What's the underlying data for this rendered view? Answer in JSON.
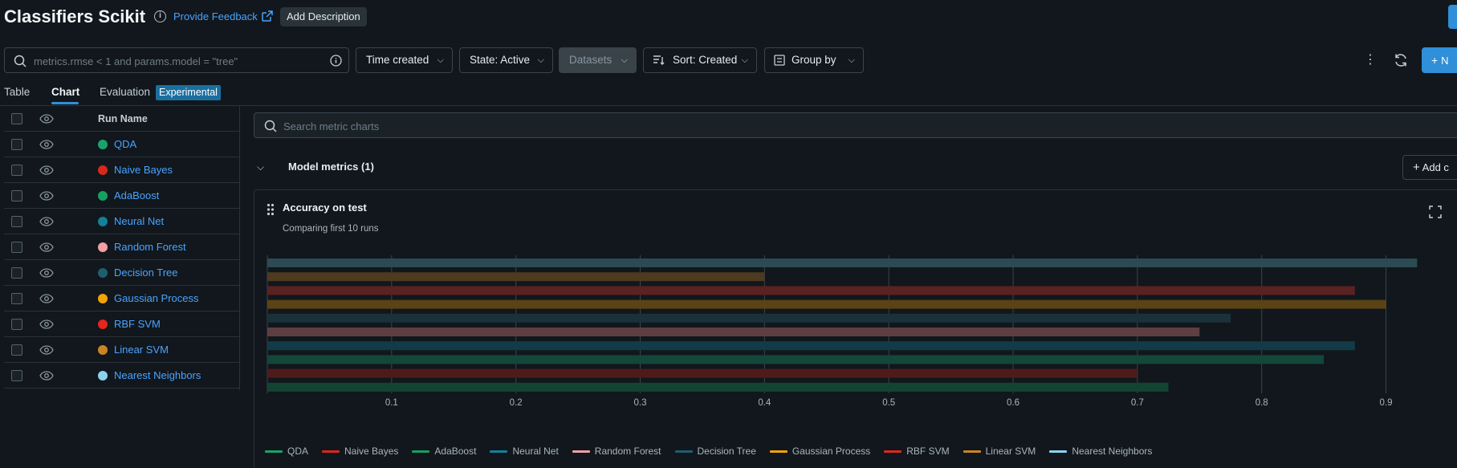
{
  "header": {
    "title": "Classifiers Scikit",
    "feedback_label": "Provide Feedback",
    "add_description_label": "Add Description"
  },
  "toolbar": {
    "search_placeholder": "metrics.rmse < 1 and params.model = \"tree\"",
    "time_created_label": "Time created",
    "state_label": "State: Active",
    "datasets_label": "Datasets",
    "sort_label": "Sort: Created",
    "group_by_label": "Group by",
    "new_label": "N"
  },
  "tabs": [
    {
      "label": "Table"
    },
    {
      "label": "Chart"
    },
    {
      "label": "Evaluation"
    }
  ],
  "experimental_badge": "Experimental",
  "runs_table": {
    "column_header": "Run Name",
    "runs": [
      {
        "name": "QDA",
        "color": "#1aa36b"
      },
      {
        "name": "Naive Bayes",
        "color": "#d6281c"
      },
      {
        "name": "AdaBoost",
        "color": "#15a062"
      },
      {
        "name": "Neural Net",
        "color": "#14809a"
      },
      {
        "name": "Random Forest",
        "color": "#f1a0a3"
      },
      {
        "name": "Decision Tree",
        "color": "#1f5e6c"
      },
      {
        "name": "Gaussian Process",
        "color": "#f0a307"
      },
      {
        "name": "RBF SVM",
        "color": "#e3261f"
      },
      {
        "name": "Linear SVM",
        "color": "#c98426"
      },
      {
        "name": "Nearest Neighbors",
        "color": "#8cd2ee"
      }
    ]
  },
  "chart_search_placeholder": "Search metric charts",
  "section": {
    "title": "Model metrics (1)",
    "add_chart_label": "Add c"
  },
  "chart_card": {
    "title": "Accuracy on test",
    "subtitle": "Comparing first 10 runs"
  },
  "chart_data": {
    "type": "bar",
    "orientation": "horizontal",
    "title": "Accuracy on test",
    "subtitle": "Comparing first 10 runs",
    "xlim": [
      0,
      0.93
    ],
    "xticks": [
      0.1,
      0.2,
      0.3,
      0.4,
      0.5,
      0.6,
      0.7,
      0.8,
      0.9
    ],
    "grid": true,
    "legend_placement": "bottom",
    "bars": [
      {
        "run": "Decision Tree",
        "value": 0.925,
        "color": "#2c4a52"
      },
      {
        "run": "Linear SVM",
        "value": 0.4,
        "color": "#4d3a1f"
      },
      {
        "run": "RBF SVM",
        "value": 0.875,
        "color": "#5a2221"
      },
      {
        "run": "Gaussian Process",
        "value": 0.9,
        "color": "#5a4314"
      },
      {
        "run": "Decision Tree",
        "value": 0.775,
        "color": "#1b313a"
      },
      {
        "run": "Random Forest",
        "value": 0.75,
        "color": "#5e3e41"
      },
      {
        "run": "Neural Net",
        "value": 0.875,
        "color": "#123b47"
      },
      {
        "run": "AdaBoost",
        "value": 0.85,
        "color": "#12473a"
      },
      {
        "run": "Naive Bayes",
        "value": 0.7,
        "color": "#4e1b1b"
      },
      {
        "run": "QDA",
        "value": 0.725,
        "color": "#134433"
      }
    ],
    "legend": [
      {
        "name": "QDA",
        "color": "#1aa36b"
      },
      {
        "name": "Naive Bayes",
        "color": "#d6281c"
      },
      {
        "name": "AdaBoost",
        "color": "#15a062"
      },
      {
        "name": "Neural Net",
        "color": "#14809a"
      },
      {
        "name": "Random Forest",
        "color": "#f1a0a3"
      },
      {
        "name": "Decision Tree",
        "color": "#1f5e6c"
      },
      {
        "name": "Gaussian Process",
        "color": "#f0a307"
      },
      {
        "name": "RBF SVM",
        "color": "#e3261f"
      },
      {
        "name": "Linear SVM",
        "color": "#c98426"
      },
      {
        "name": "Nearest Neighbors",
        "color": "#8cd2ee"
      }
    ]
  }
}
